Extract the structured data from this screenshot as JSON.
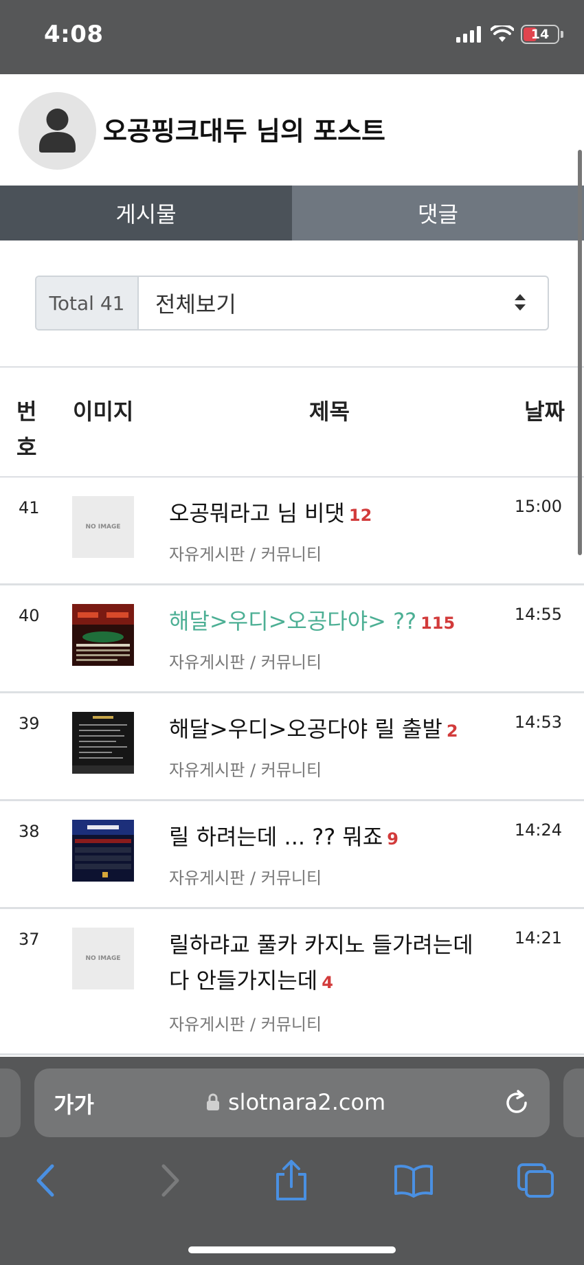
{
  "status": {
    "time": "4:08",
    "battery": "14"
  },
  "profile": {
    "title": "오공핑크대두 님의 포스트"
  },
  "tabs": [
    {
      "label": "게시물",
      "active": true
    },
    {
      "label": "댓글",
      "active": false
    }
  ],
  "filter": {
    "total_label": "Total 41",
    "select_value": "전체보기"
  },
  "table": {
    "headers": {
      "num": "번호",
      "image": "이미지",
      "title": "제목",
      "date": "날짜"
    },
    "rows": [
      {
        "num": "41",
        "image": "NO IMAGE",
        "title": "오공뭐라고 님 비댓",
        "comments": "12",
        "board": "자유게시판 / 커뮤니티",
        "time": "15:00"
      },
      {
        "num": "40",
        "image": "thumb",
        "title": "해달>우디>오공다야> ??",
        "comments": "115",
        "board": "자유게시판 / 커뮤니티",
        "time": "14:55"
      },
      {
        "num": "39",
        "image": "thumb",
        "title": "해달>우디>오공다야 릴 출발",
        "comments": "2",
        "board": "자유게시판 / 커뮤니티",
        "time": "14:53"
      },
      {
        "num": "38",
        "image": "thumb",
        "title": "릴 하려는데 ... ?? 뭐죠",
        "comments": "9",
        "board": "자유게시판 / 커뮤니티",
        "time": "14:24"
      },
      {
        "num": "37",
        "image": "NO IMAGE",
        "title": "릴하랴교 풀카 카지노 들가려는데 다 안들가지는데",
        "comments": "4",
        "board": "자유게시판 / 커뮤니티",
        "time": "14:21"
      }
    ]
  },
  "browser": {
    "text_size_button": "가가",
    "url": "slotnara2.com"
  },
  "colors": {
    "visited_title": "#4caf94",
    "comment_count": "#d23b3b",
    "tab_active": "#4b5259",
    "tab_inactive": "#6f7780",
    "accent_blue": "#4a90e2"
  }
}
